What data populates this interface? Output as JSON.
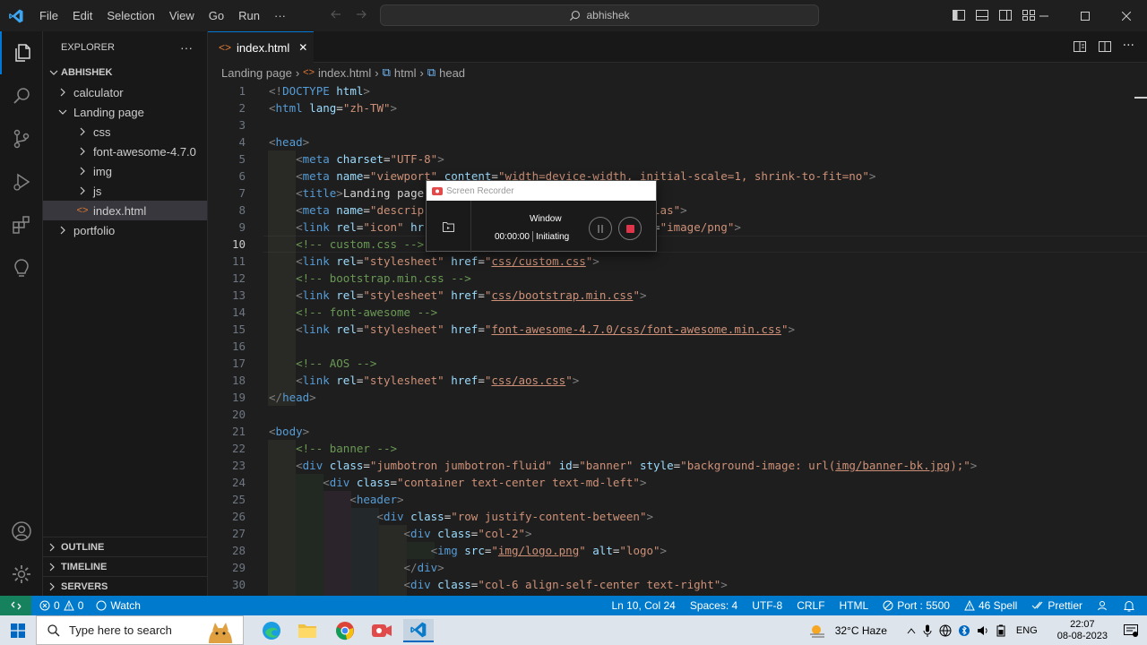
{
  "menu": [
    "File",
    "Edit",
    "Selection",
    "View",
    "Go",
    "Run",
    "···"
  ],
  "search": {
    "text": "abhishek"
  },
  "explorer": {
    "title": "EXPLORER",
    "more": "···",
    "root": "ABHISHEK",
    "items": [
      {
        "label": "calculator",
        "type": "folder",
        "open": false,
        "depth": 1
      },
      {
        "label": "Landing page",
        "type": "folder",
        "open": true,
        "depth": 1
      },
      {
        "label": "css",
        "type": "folder",
        "open": false,
        "depth": 2
      },
      {
        "label": "font-awesome-4.7.0",
        "type": "folder",
        "open": false,
        "depth": 2
      },
      {
        "label": "img",
        "type": "folder",
        "open": false,
        "depth": 2
      },
      {
        "label": "js",
        "type": "folder",
        "open": false,
        "depth": 2
      },
      {
        "label": "index.html",
        "type": "file",
        "open": false,
        "depth": 2,
        "selected": true
      },
      {
        "label": "portfolio",
        "type": "folder",
        "open": false,
        "depth": 1
      }
    ],
    "sections": [
      "OUTLINE",
      "TIMELINE",
      "SERVERS"
    ]
  },
  "tab": {
    "label": "index.html",
    "close": "✕"
  },
  "breadcrumb": [
    "Landing page",
    "index.html",
    "html",
    "head"
  ],
  "code": [
    {
      "n": 1,
      "html": "<span class='t'>&lt;!</span><span class='tg'>DOCTYPE</span> <span class='a'>html</span><span class='t'>&gt;</span>"
    },
    {
      "n": 2,
      "html": "<span class='t'>&lt;</span><span class='tg'>html</span> <span class='a'>lang</span><span class='w'>=</span><span class='s'>\"zh-TW\"</span><span class='t'>&gt;</span>"
    },
    {
      "n": 3,
      "html": ""
    },
    {
      "n": 4,
      "html": "<span class='t'>&lt;</span><span class='tg'>head</span><span class='t'>&gt;</span>"
    },
    {
      "n": 5,
      "html": "    <span class='t'>&lt;</span><span class='tg'>meta</span> <span class='a'>charset</span><span class='w'>=</span><span class='s'>\"UTF-8\"</span><span class='t'>&gt;</span>"
    },
    {
      "n": 6,
      "html": "    <span class='t'>&lt;</span><span class='tg'>meta</span> <span class='a'>name</span><span class='w'>=</span><span class='s'>\"viewport\"</span> <span class='a'>content</span><span class='w'>=</span><span class='s'>\"width=device-width, initial-scale=1, shrink-to-fit=no\"</span><span class='t'>&gt;</span>"
    },
    {
      "n": 7,
      "html": "    <span class='t'>&lt;</span><span class='tg'>title</span><span class='t'>&gt;</span><span class='w'>Landing page</span>"
    },
    {
      "n": 8,
      "html": "    <span class='t'>&lt;</span><span class='tg'>meta</span> <span class='a'>name</span><span class='w'>=</span><span class='s'>\"descrip</span>                          <span class='s'>plate Atlas\"</span><span class='t'>&gt;</span>"
    },
    {
      "n": 9,
      "html": "    <span class='t'>&lt;</span><span class='tg'>link</span> <span class='a'>rel</span><span class='w'>=</span><span class='s'>\"icon\"</span> <span class='a'>hr</span>                            <span class='s'>\"</span> <span class='a'>type</span><span class='w'>=</span><span class='s'>\"image/png\"</span><span class='t'>&gt;</span>"
    },
    {
      "n": 10,
      "html": "    <span class='c'>&lt;!-- custom.css --&gt;</span>",
      "current": true
    },
    {
      "n": 11,
      "html": "    <span class='t'>&lt;</span><span class='tg'>link</span> <span class='a'>rel</span><span class='w'>=</span><span class='s'>\"stylesheet\"</span> <span class='a'>href</span><span class='w'>=</span><span class='s'>\"<span class='u'>css/custom.css</span>\"</span><span class='t'>&gt;</span>"
    },
    {
      "n": 12,
      "html": "    <span class='c'>&lt;!-- bootstrap.min.css --&gt;</span>"
    },
    {
      "n": 13,
      "html": "    <span class='t'>&lt;</span><span class='tg'>link</span> <span class='a'>rel</span><span class='w'>=</span><span class='s'>\"stylesheet\"</span> <span class='a'>href</span><span class='w'>=</span><span class='s'>\"<span class='u'>css/bootstrap.min.css</span>\"</span><span class='t'>&gt;</span>"
    },
    {
      "n": 14,
      "html": "    <span class='c'>&lt;!-- font-awesome --&gt;</span>"
    },
    {
      "n": 15,
      "html": "    <span class='t'>&lt;</span><span class='tg'>link</span> <span class='a'>rel</span><span class='w'>=</span><span class='s'>\"stylesheet\"</span> <span class='a'>href</span><span class='w'>=</span><span class='s'>\"<span class='u'>font-awesome-4.7.0/css/font-awesome.min.css</span>\"</span><span class='t'>&gt;</span>"
    },
    {
      "n": 16,
      "html": ""
    },
    {
      "n": 17,
      "html": "    <span class='c'>&lt;!-- AOS --&gt;</span>"
    },
    {
      "n": 18,
      "html": "    <span class='t'>&lt;</span><span class='tg'>link</span> <span class='a'>rel</span><span class='w'>=</span><span class='s'>\"stylesheet\"</span> <span class='a'>href</span><span class='w'>=</span><span class='s'>\"<span class='u'>css/aos.css</span>\"</span><span class='t'>&gt;</span>"
    },
    {
      "n": 19,
      "html": "<span class='t'>&lt;/</span><span class='tg'>head</span><span class='t'>&gt;</span>"
    },
    {
      "n": 20,
      "html": ""
    },
    {
      "n": 21,
      "html": "<span class='t'>&lt;</span><span class='tg'>body</span><span class='t'>&gt;</span>"
    },
    {
      "n": 22,
      "html": "    <span class='c'>&lt;!-- banner --&gt;</span>"
    },
    {
      "n": 23,
      "html": "    <span class='t'>&lt;</span><span class='tg'>div</span> <span class='a'>class</span><span class='w'>=</span><span class='s'>\"jumbotron jumbotron-fluid\"</span> <span class='a'>id</span><span class='w'>=</span><span class='s'>\"banner\"</span> <span class='a'>style</span><span class='w'>=</span><span class='s'>\"background-image: url(<span class='u'>img/banner-bk.jpg</span>);\"</span><span class='t'>&gt;</span>"
    },
    {
      "n": 24,
      "html": "        <span class='t'>&lt;</span><span class='tg'>div</span> <span class='a'>class</span><span class='w'>=</span><span class='s'>\"container text-center text-md-left\"</span><span class='t'>&gt;</span>"
    },
    {
      "n": 25,
      "html": "            <span class='t'>&lt;</span><span class='tg'>header</span><span class='t'>&gt;</span>"
    },
    {
      "n": 26,
      "html": "                <span class='t'>&lt;</span><span class='tg'>div</span> <span class='a'>class</span><span class='w'>=</span><span class='s'>\"row justify-content-between\"</span><span class='t'>&gt;</span>"
    },
    {
      "n": 27,
      "html": "                    <span class='t'>&lt;</span><span class='tg'>div</span> <span class='a'>class</span><span class='w'>=</span><span class='s'>\"col-2\"</span><span class='t'>&gt;</span>"
    },
    {
      "n": 28,
      "html": "                        <span class='t'>&lt;</span><span class='tg'>img</span> <span class='a'>src</span><span class='w'>=</span><span class='s'>\"<span class='u'>img/logo.png</span>\"</span> <span class='a'>alt</span><span class='w'>=</span><span class='s'>\"logo\"</span><span class='t'>&gt;</span>"
    },
    {
      "n": 29,
      "html": "                    <span class='t'>&lt;/</span><span class='tg'>div</span><span class='t'>&gt;</span>"
    },
    {
      "n": 30,
      "html": "                    <span class='t'>&lt;</span><span class='tg'>div</span> <span class='a'>class</span><span class='w'>=</span><span class='s'>\"col-6 align-self-center text-right\"</span><span class='t'>&gt;</span>"
    }
  ],
  "recorder": {
    "title": "Screen Recorder",
    "mode": "Window",
    "time": "00:00:00",
    "status": "Initiating"
  },
  "status": {
    "errors": "0",
    "warnings": "0",
    "watch": "Watch",
    "position": "Ln 10, Col 24",
    "spaces": "Spaces: 4",
    "encoding": "UTF-8",
    "eol": "CRLF",
    "language": "HTML",
    "port": "Port : 5500",
    "spell": "46 Spell",
    "prettier": "Prettier"
  },
  "taskbar": {
    "search_placeholder": "Type here to search",
    "weather": "32°C  Haze",
    "lang": "ENG",
    "time": "22:07",
    "date": "08-08-2023"
  },
  "colors": {
    "accent": "#007acc",
    "remote": "#16825d",
    "tag": "#569cd6",
    "attr": "#9cdcfe",
    "string": "#ce9178",
    "comment": "#6a9955"
  }
}
